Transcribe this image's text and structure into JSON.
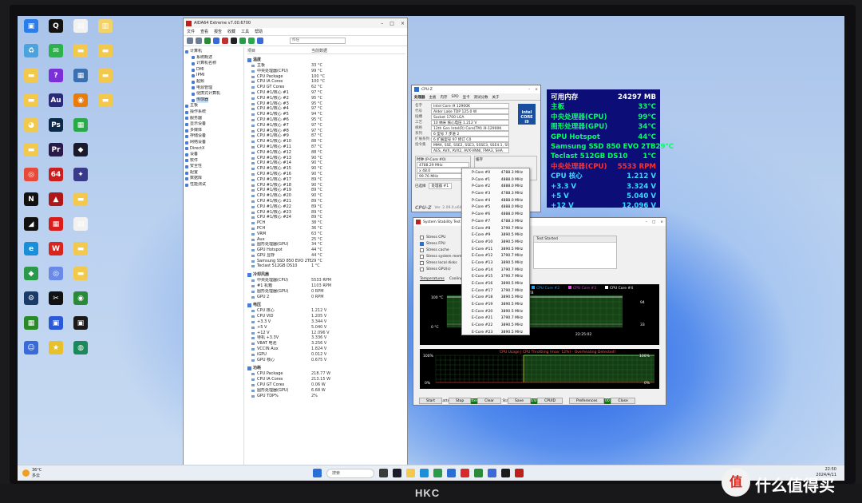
{
  "desktop": {
    "icons": [
      {
        "label": "",
        "color": "#2b7de9",
        "glyph": "▣"
      },
      {
        "label": "",
        "color": "#111111",
        "glyph": "Q"
      },
      {
        "label": "",
        "color": "#f2f2f2",
        "glyph": "▤"
      },
      {
        "label": "",
        "color": "#f2d26b",
        "glyph": "▥"
      },
      {
        "label": "",
        "color": "#4aa3df",
        "glyph": "♻"
      },
      {
        "label": "",
        "color": "#2bb34a",
        "glyph": "✉"
      },
      {
        "label": "",
        "color": "#f2c94c",
        "glyph": "▬"
      },
      {
        "label": "",
        "color": "#f2c94c",
        "glyph": "▬"
      },
      {
        "label": "",
        "color": "#f2c94c",
        "glyph": "▬"
      },
      {
        "label": "",
        "color": "#7b2fd8",
        "glyph": "?"
      },
      {
        "label": "",
        "color": "#3a6fb0",
        "glyph": "▦"
      },
      {
        "label": "",
        "color": "#f2c94c",
        "glyph": "▬"
      },
      {
        "label": "",
        "color": "#f2c94c",
        "glyph": "▬"
      },
      {
        "label": "",
        "color": "#2a2a7a",
        "glyph": "Au"
      },
      {
        "label": "",
        "color": "#e87d0d",
        "glyph": "◉"
      },
      {
        "label": "",
        "color": "#f2c94c",
        "glyph": "▬"
      },
      {
        "label": "",
        "color": "#f2c94c",
        "glyph": "◕"
      },
      {
        "label": "",
        "color": "#0b2a4a",
        "glyph": "Ps"
      },
      {
        "label": "",
        "color": "#2aa84a",
        "glyph": "▦"
      },
      {
        "label": "",
        "color": "#ffffff",
        "glyph": ""
      },
      {
        "label": "",
        "color": "#f2c94c",
        "glyph": "▬"
      },
      {
        "label": "",
        "color": "#2a1a4a",
        "glyph": "Pr"
      },
      {
        "label": "",
        "color": "#1a1a2a",
        "glyph": "◆"
      },
      {
        "label": "",
        "color": "#ffffff",
        "glyph": ""
      },
      {
        "label": "",
        "color": "#e84a3a",
        "glyph": "◎"
      },
      {
        "label": "",
        "color": "#cc1e1e",
        "glyph": "64"
      },
      {
        "label": "",
        "color": "#3a3a8a",
        "glyph": "✦"
      },
      {
        "label": "",
        "color": "#ffffff",
        "glyph": ""
      },
      {
        "label": "",
        "color": "#111111",
        "glyph": "N"
      },
      {
        "label": "",
        "color": "#b01818",
        "glyph": "▲"
      },
      {
        "label": "",
        "color": "#f2c94c",
        "glyph": "▬"
      },
      {
        "label": "",
        "color": "#ffffff",
        "glyph": ""
      },
      {
        "label": "",
        "color": "#111111",
        "glyph": "◢"
      },
      {
        "label": "",
        "color": "#d91c1c",
        "glyph": "▦"
      },
      {
        "label": "",
        "color": "#f2f2f2",
        "glyph": "▤"
      },
      {
        "label": "",
        "color": "#ffffff",
        "glyph": ""
      },
      {
        "label": "",
        "color": "#1a8fd8",
        "glyph": "e"
      },
      {
        "label": "",
        "color": "#d8261e",
        "glyph": "W"
      },
      {
        "label": "",
        "color": "#f2c94c",
        "glyph": "▬"
      },
      {
        "label": "",
        "color": "#ffffff",
        "glyph": ""
      },
      {
        "label": "",
        "color": "#2a9a4a",
        "glyph": "◆"
      },
      {
        "label": "",
        "color": "#6a8ae8",
        "glyph": "◎"
      },
      {
        "label": "",
        "color": "#f2c94c",
        "glyph": "▬"
      },
      {
        "label": "",
        "color": "#ffffff",
        "glyph": ""
      },
      {
        "label": "",
        "color": "#1a3a6a",
        "glyph": "⚙"
      },
      {
        "label": "",
        "color": "#111111",
        "glyph": "✂"
      },
      {
        "label": "",
        "color": "#2a8a3a",
        "glyph": "◉"
      },
      {
        "label": "",
        "color": "#ffffff",
        "glyph": ""
      },
      {
        "label": "",
        "color": "#2a8a2a",
        "glyph": "▦"
      },
      {
        "label": "",
        "color": "#2a5ad8",
        "glyph": "▣"
      },
      {
        "label": "",
        "color": "#1a1a1a",
        "glyph": "▣"
      },
      {
        "label": "",
        "color": "#ffffff",
        "glyph": ""
      },
      {
        "label": "",
        "color": "#3a6ad8",
        "glyph": "☺"
      },
      {
        "label": "",
        "color": "#e8c02a",
        "glyph": "★"
      },
      {
        "label": "",
        "color": "#1a8a5a",
        "glyph": "◍"
      }
    ]
  },
  "aida": {
    "title": "AIDA64 Extreme v7.00.6700",
    "menu": [
      "文件",
      "查看",
      "报告",
      "收藏",
      "工具",
      "帮助"
    ],
    "search_placeholder": "作任",
    "tree": [
      "计算机",
      "系统概述",
      "计算机名称",
      "DMI",
      "IPMI",
      "超频",
      "电源管理",
      "便携式计算机",
      "传感器",
      "主板",
      "操作系统",
      "服务器",
      "显示设备",
      "多媒体",
      "存储设备",
      "网络设备",
      "DirectX",
      "设备",
      "软件",
      "安全性",
      "配置",
      "数据库",
      "性能测试"
    ],
    "col_item": "项目",
    "col_value": "当前数据",
    "sections": [
      {
        "title": "温度",
        "rows": [
          [
            "主板",
            "33 °C"
          ],
          [
            "中央处理器(CPU)",
            "99 °C"
          ],
          [
            "CPU Package",
            "100 °C"
          ],
          [
            "CPU IA Cores",
            "100 °C"
          ],
          [
            "CPU GT Cores",
            "62 °C"
          ],
          [
            "CPU #1/核心 #1",
            "97 °C"
          ],
          [
            "CPU #1/核心 #2",
            "95 °C"
          ],
          [
            "CPU #1/核心 #3",
            "95 °C"
          ],
          [
            "CPU #1/核心 #4",
            "97 °C"
          ],
          [
            "CPU #1/核心 #5",
            "94 °C"
          ],
          [
            "CPU #1/核心 #6",
            "95 °C"
          ],
          [
            "CPU #1/核心 #7",
            "97 °C"
          ],
          [
            "CPU #1/核心 #8",
            "97 °C"
          ],
          [
            "CPU #1/核心 #9",
            "87 °C"
          ],
          [
            "CPU #1/核心 #10",
            "88 °C"
          ],
          [
            "CPU #1/核心 #11",
            "87 °C"
          ],
          [
            "CPU #1/核心 #12",
            "88 °C"
          ],
          [
            "CPU #1/核心 #13",
            "90 °C"
          ],
          [
            "CPU #1/核心 #14",
            "90 °C"
          ],
          [
            "CPU #1/核心 #15",
            "90 °C"
          ],
          [
            "CPU #1/核心 #16",
            "90 °C"
          ],
          [
            "CPU #1/核心 #17",
            "89 °C"
          ],
          [
            "CPU #1/核心 #18",
            "90 °C"
          ],
          [
            "CPU #1/核心 #19",
            "89 °C"
          ],
          [
            "CPU #1/核心 #20",
            "90 °C"
          ],
          [
            "CPU #1/核心 #21",
            "89 °C"
          ],
          [
            "CPU #1/核心 #22",
            "89 °C"
          ],
          [
            "CPU #1/核心 #23",
            "89 °C"
          ],
          [
            "CPU #1/核心 #24",
            "89 °C"
          ],
          [
            "PCH",
            "38 °C"
          ],
          [
            "PCH",
            "36 °C"
          ],
          [
            "VRM",
            "63 °C"
          ],
          [
            "Aux",
            "25 °C"
          ],
          [
            "图形处理器(GPU)",
            "34 °C"
          ],
          [
            "GPU Hotspot",
            "44 °C"
          ],
          [
            "GPU 显存",
            "44 °C"
          ],
          [
            "Samsung SSD 850 EVO 2TB",
            "29 °C"
          ],
          [
            "Teclast 512GB DS10",
            "1 °C"
          ]
        ]
      },
      {
        "title": "冷却风扇",
        "rows": [
          [
            "中央处理器(CPU)",
            "5533 RPM"
          ],
          [
            "#1 机箱",
            "1103 RPM"
          ],
          [
            "图形处理器(GPU)",
            "0 RPM"
          ],
          [
            "GPU 2",
            "0 RPM"
          ]
        ]
      },
      {
        "title": "电压",
        "rows": [
          [
            "CPU 核心",
            "1.212 V"
          ],
          [
            "CPU VID",
            "1.205 V"
          ],
          [
            "+3.3 V",
            "3.344 V"
          ],
          [
            "+5 V",
            "5.040 V"
          ],
          [
            "+12 V",
            "12.096 V"
          ],
          [
            "待机 +3.3V",
            "3.336 V"
          ],
          [
            "VBAT 电池",
            "3.256 V"
          ],
          [
            "VCCIN Aux",
            "1.824 V"
          ],
          [
            "iGPU",
            "0.012 V"
          ],
          [
            "GPU 核心",
            "0.675 V"
          ]
        ]
      },
      {
        "title": "功耗",
        "rows": [
          [
            "CPU Package",
            "218.77 W"
          ],
          [
            "CPU IA Cores",
            "213.15 W"
          ],
          [
            "CPU GT Cores",
            "0.06 W"
          ],
          [
            "图形处理器(GPU)",
            "6.68 W"
          ],
          [
            "GPU TDP%",
            "2%"
          ]
        ]
      }
    ]
  },
  "osd": {
    "rows": [
      {
        "label": "可用内存",
        "value": "24297 MB",
        "label_color": "#ffffff",
        "value_color": "#ffffff"
      },
      {
        "label": "主板",
        "value": "33°C",
        "label_color": "#00ff66",
        "value_color": "#00ff66"
      },
      {
        "label": "中央处理器(CPU)",
        "value": "99°C",
        "label_color": "#00ff66",
        "value_color": "#00ff66"
      },
      {
        "label": "图形处理器(GPU)",
        "value": "34°C",
        "label_color": "#00ff66",
        "value_color": "#00ff66"
      },
      {
        "label": "GPU Hotspot",
        "value": "44°C",
        "label_color": "#00ff66",
        "value_color": "#00ff66"
      },
      {
        "label": "Samsung SSD 850 EVO 2TB",
        "value": "29°C",
        "label_color": "#00ff66",
        "value_color": "#00ff66"
      },
      {
        "label": "Teclast 512GB DS10",
        "value": "1°C",
        "label_color": "#00ff66",
        "value_color": "#00ff66"
      },
      {
        "label": "中央处理器(CPU)",
        "value": "5533 RPM",
        "label_color": "#ff3030",
        "value_color": "#ff3030"
      },
      {
        "label": "CPU 核心",
        "value": "1.212 V",
        "label_color": "#39d9ff",
        "value_color": "#39d9ff"
      },
      {
        "label": "+3.3 V",
        "value": "3.324 V",
        "label_color": "#39d9ff",
        "value_color": "#39d9ff"
      },
      {
        "label": "+5 V",
        "value": "5.040 V",
        "label_color": "#39d9ff",
        "value_color": "#39d9ff"
      },
      {
        "label": "+12 V",
        "value": "12.096 V",
        "label_color": "#39d9ff",
        "value_color": "#39d9ff"
      }
    ]
  },
  "cpuz": {
    "title": "CPU-Z",
    "tabs": [
      "处理器",
      "主板",
      "内存",
      "SPD",
      "显卡",
      "测试分数",
      "关于"
    ],
    "fields": [
      {
        "label": "名字",
        "value": "Intel Core i9 12900K"
      },
      {
        "label": "代号",
        "value": "Alder Lake     TDP   125.0 W"
      },
      {
        "label": "插槽",
        "value": "Socket 1700 LGA"
      },
      {
        "label": "工艺",
        "value": "10 纳米      核心电压   1.212 V"
      },
      {
        "label": "规格",
        "value": "12th Gen Intel(R) Core(TM) i9-12900K"
      },
      {
        "label": "系列",
        "value": "6     型号  7     步进  2"
      },
      {
        "label": "扩展系列",
        "value": "6     扩展型号  97    修订  C0"
      },
      {
        "label": "指令集",
        "value": "MMX, SSE, SSE2, SSE3, SSSE3, SSE4.1, SSE4.2, EM64T, VT-x,"
      },
      {
        "label": "",
        "value": "AES, AVX, AVX2, AVX-VNNI, FMA3, SHA"
      }
    ],
    "clock_label": "时钟 (P-Core #0)",
    "core_speed": "4788.29 MHz",
    "multiplier": "x 48.0",
    "bus_speed": "99.76 MHz",
    "cache_label": "缓存",
    "select_label": "已选择",
    "select_value": "处理器 #1",
    "version": "Ver. 2.09.0.x64",
    "brand": "CPU-Z",
    "intel_text": "intel CORE i9"
  },
  "coremenu": {
    "items": [
      [
        "P-Core #0",
        "4788.3 MHz"
      ],
      [
        "P-Core #1",
        "4888.0 MHz"
      ],
      [
        "P-Core #2",
        "4888.0 MHz"
      ],
      [
        "P-Core #3",
        "4788.3 MHz"
      ],
      [
        "P-Core #4",
        "4888.0 MHz"
      ],
      [
        "P-Core #5",
        "4888.0 MHz"
      ],
      [
        "P-Core #6",
        "4888.0 MHz"
      ],
      [
        "P-Core #7",
        "4788.3 MHz"
      ],
      [
        "E-Core #8",
        "3790.7 MHz"
      ],
      [
        "E-Core #9",
        "3890.5 MHz"
      ],
      [
        "E-Core #10",
        "3890.5 MHz"
      ],
      [
        "E-Core #11",
        "3890.5 MHz"
      ],
      [
        "E-Core #12",
        "3790.7 MHz"
      ],
      [
        "E-Core #13",
        "3890.5 MHz"
      ],
      [
        "E-Core #14",
        "3790.7 MHz"
      ],
      [
        "E-Core #15",
        "3790.7 MHz"
      ],
      [
        "E-Core #16",
        "3890.5 MHz"
      ],
      [
        "E-Core #17",
        "3790.7 MHz"
      ],
      [
        "E-Core #18",
        "3890.5 MHz"
      ],
      [
        "E-Core #19",
        "3890.5 MHz"
      ],
      [
        "E-Core #20",
        "3890.5 MHz"
      ],
      [
        "E-Core #21",
        "3790.7 MHz"
      ],
      [
        "E-Core #22",
        "3890.5 MHz"
      ],
      [
        "E-Core #23",
        "3890.5 MHz"
      ]
    ]
  },
  "sst": {
    "title": "System Stability Test",
    "checks": [
      {
        "label": "Stress CPU",
        "on": false
      },
      {
        "label": "Stress FPU",
        "on": true
      },
      {
        "label": "Stress cache",
        "on": false
      },
      {
        "label": "Stress system memory",
        "on": false
      },
      {
        "label": "Stress local disks",
        "on": false
      },
      {
        "label": "Stress GPU(s)",
        "on": false
      }
    ],
    "table_head": "Test Started",
    "tabs": [
      "Temperatures",
      "Cooling Fans",
      "Statistics"
    ],
    "legend": [
      "CPU Core #2",
      "CPU Core #3",
      "CPU Core #4"
    ],
    "legend_colors": [
      "#2a9ef2",
      "#d84ad8",
      "#ffffff"
    ],
    "graph1_top": "100 °C",
    "graph1_bottom": "0 °C",
    "graph1_series": "Samsung SSD 850 EVO 2TB",
    "graph1_time": "22:25:02",
    "graph1_right_top": "94",
    "graph1_right_bottom": "33",
    "graph2_title": "CPU Usage  |  CPU Throttling (max: 12%) - Overheating Detected!",
    "graph2_top": "100%",
    "graph2_bottom": "0%",
    "graph2_right_top": "100%",
    "graph2_right_bottom": "0%",
    "remaining_label": "Remaining Battery:",
    "remaining_value": "No battery",
    "started_label": "Test Started:",
    "started_value": "2024/4/11 22:25:02",
    "elapsed_label": "Elapsed Time:",
    "elapsed_value": "00:25:14",
    "buttons": [
      "Start",
      "Stop",
      "Clear",
      "Save",
      "CPUID",
      "Preferences",
      "Close"
    ]
  },
  "taskbar": {
    "temp": "36°C",
    "weather": "多云",
    "search": "搜索",
    "time": "22:50",
    "date": "2024/4/11"
  },
  "photo": {
    "brand": "HKC",
    "watermark": "什么值得买",
    "watermark_mark": "值"
  }
}
